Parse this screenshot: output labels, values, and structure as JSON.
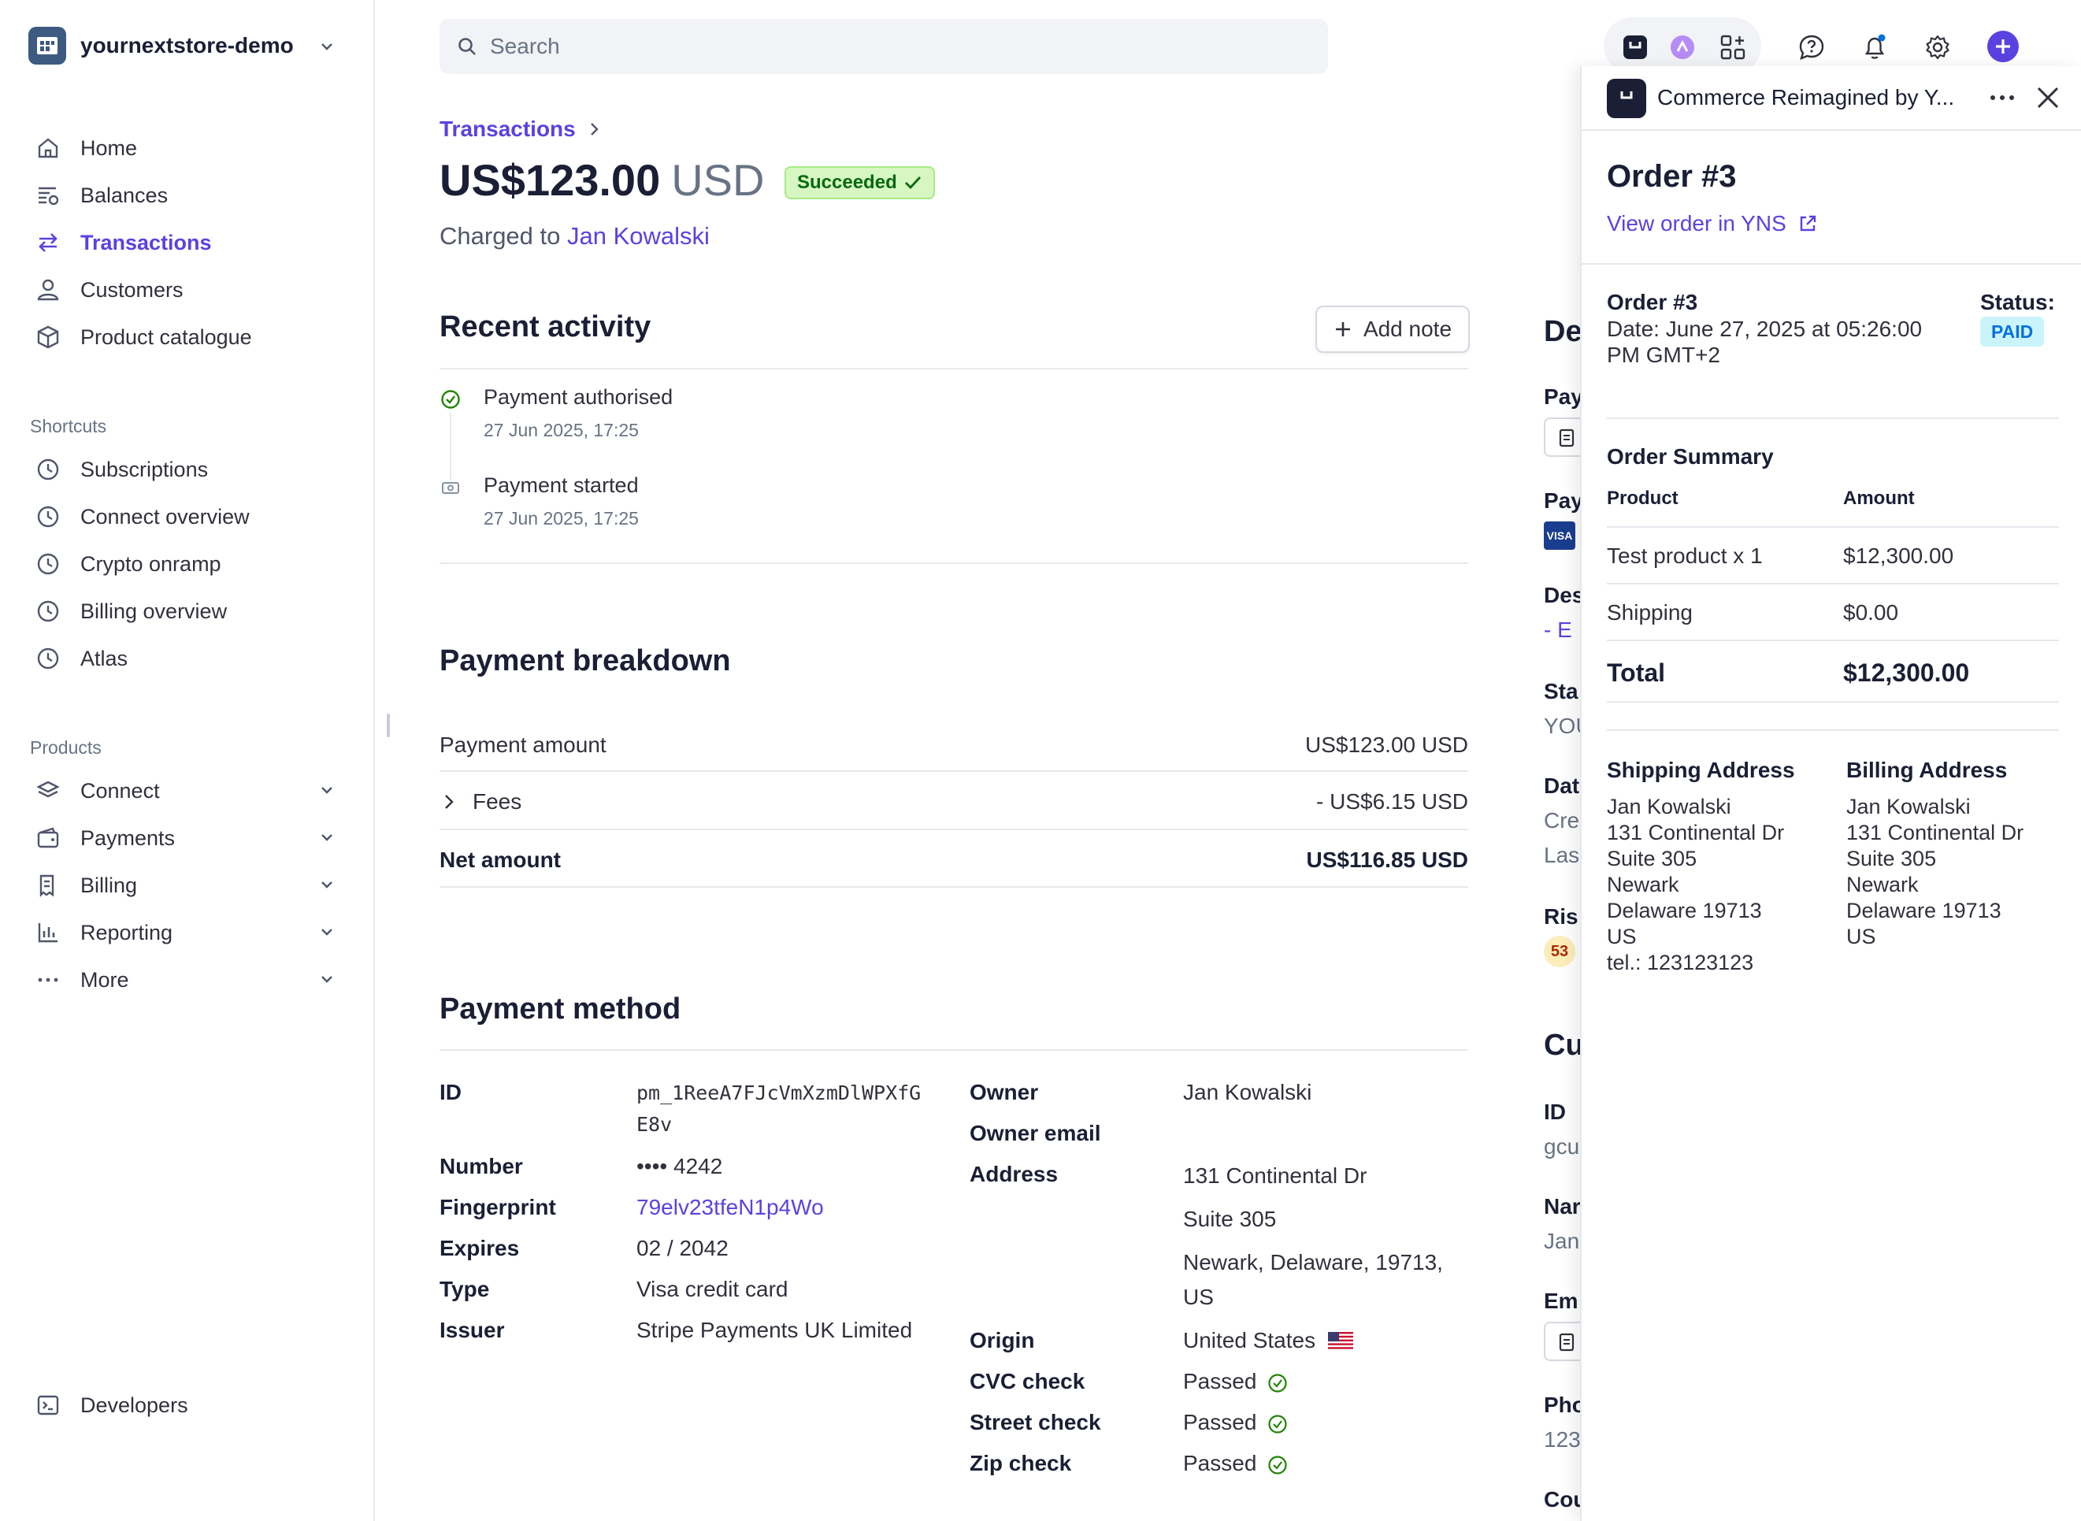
{
  "account": {
    "name": "yournextstore-demo"
  },
  "nav": {
    "items": [
      {
        "label": "Home",
        "icon": "home-icon"
      },
      {
        "label": "Balances",
        "icon": "balances-icon"
      },
      {
        "label": "Transactions",
        "icon": "transactions-icon",
        "active": true
      },
      {
        "label": "Customers",
        "icon": "customers-icon"
      },
      {
        "label": "Product catalogue",
        "icon": "product-catalogue-icon"
      }
    ],
    "shortcuts_label": "Shortcuts",
    "shortcuts": [
      "Subscriptions",
      "Connect overview",
      "Crypto onramp",
      "Billing overview",
      "Atlas"
    ],
    "products_label": "Products",
    "products": [
      {
        "label": "Connect",
        "icon": "connect-icon"
      },
      {
        "label": "Payments",
        "icon": "payments-icon"
      },
      {
        "label": "Billing",
        "icon": "billing-icon"
      },
      {
        "label": "Reporting",
        "icon": "reporting-icon"
      },
      {
        "label": "More",
        "icon": "more-icon"
      }
    ],
    "developers": "Developers"
  },
  "search": {
    "placeholder": "Search"
  },
  "header": {
    "breadcrumb": "Transactions",
    "amount": "US$123.00",
    "currency": "USD",
    "status": "Succeeded",
    "charged_prefix": "Charged to",
    "customer": "Jan Kowalski"
  },
  "activity": {
    "title": "Recent activity",
    "add_note": "Add note",
    "events": [
      {
        "title": "Payment authorised",
        "time": "27 Jun 2025, 17:25"
      },
      {
        "title": "Payment started",
        "time": "27 Jun 2025, 17:25"
      }
    ]
  },
  "breakdown": {
    "title": "Payment breakdown",
    "rows": [
      {
        "label": "Payment amount",
        "value": "US$123.00 USD"
      },
      {
        "label": "Fees",
        "value": "- US$6.15 USD"
      },
      {
        "label": "Net amount",
        "value": "US$116.85 USD"
      }
    ]
  },
  "payment_method": {
    "title": "Payment method",
    "left": {
      "id_label": "ID",
      "id_line1": "pm_1ReeA7FJcVmXzmDlWPXfG",
      "id_line2": "E8v",
      "number_label": "Number",
      "number": "•••• 4242",
      "fingerprint_label": "Fingerprint",
      "fingerprint": "79elv23tfeN1p4Wo",
      "expires_label": "Expires",
      "expires": "02 / 2042",
      "type_label": "Type",
      "type": "Visa credit card",
      "issuer_label": "Issuer",
      "issuer": "Stripe Payments UK Limited"
    },
    "right": {
      "owner_label": "Owner",
      "owner": "Jan Kowalski",
      "email_label": "Owner email",
      "address_label": "Address",
      "address1": "131 Continental Dr",
      "address2": "Suite 305",
      "address3": "Newark, Delaware, 19713,",
      "address4": "US",
      "origin_label": "Origin",
      "origin": "United States",
      "cvc_label": "CVC check",
      "cvc": "Passed",
      "street_label": "Street check",
      "street": "Passed",
      "zip_label": "Zip check",
      "zip": "Passed"
    }
  },
  "peek": {
    "de": "De",
    "pay1": "Pay",
    "pay2": "Pay",
    "des": "Des",
    "des_link": "- E",
    "sta": "Sta",
    "sta_val": "YOU",
    "dat": "Dat",
    "cre": "Cre",
    "las": "Las",
    "ris": "Ris",
    "risk_score": "53",
    "cu": "Cu",
    "id": "ID",
    "id_link": "gcu",
    "nar": "Nar",
    "nar_val": "Jan",
    "em": "Em",
    "pho": "Pho",
    "pho_val": "123",
    "cou": "Cou"
  },
  "panel": {
    "app_name": "Commerce Reimagined by Y...",
    "order_title": "Order #3",
    "view_order": "View order in YNS",
    "order_no": "Order #3",
    "date_line1": "Date: June 27, 2025 at 05:26:00",
    "date_line2": "PM GMT+2",
    "status_label": "Status:",
    "status": "PAID",
    "summary_title": "Order Summary",
    "col_product": "Product",
    "col_amount": "Amount",
    "rows": [
      {
        "product": "Test product x 1",
        "amount": "$12,300.00"
      },
      {
        "product": "Shipping",
        "amount": "$0.00"
      }
    ],
    "total_label": "Total",
    "total": "$12,300.00",
    "shipping_title": "Shipping Address",
    "billing_title": "Billing Address",
    "shipping": [
      "Jan Kowalski",
      "131 Continental Dr",
      "Suite 305",
      "Newark",
      "Delaware 19713",
      "US",
      "tel.: 123123123"
    ],
    "billing": [
      "Jan Kowalski",
      "131 Continental Dr",
      "Suite 305",
      "Newark",
      "Delaware 19713",
      "US"
    ]
  },
  "colors": {
    "accent": "#5a42e0",
    "success": "#05690d",
    "paid": "#0570de"
  }
}
